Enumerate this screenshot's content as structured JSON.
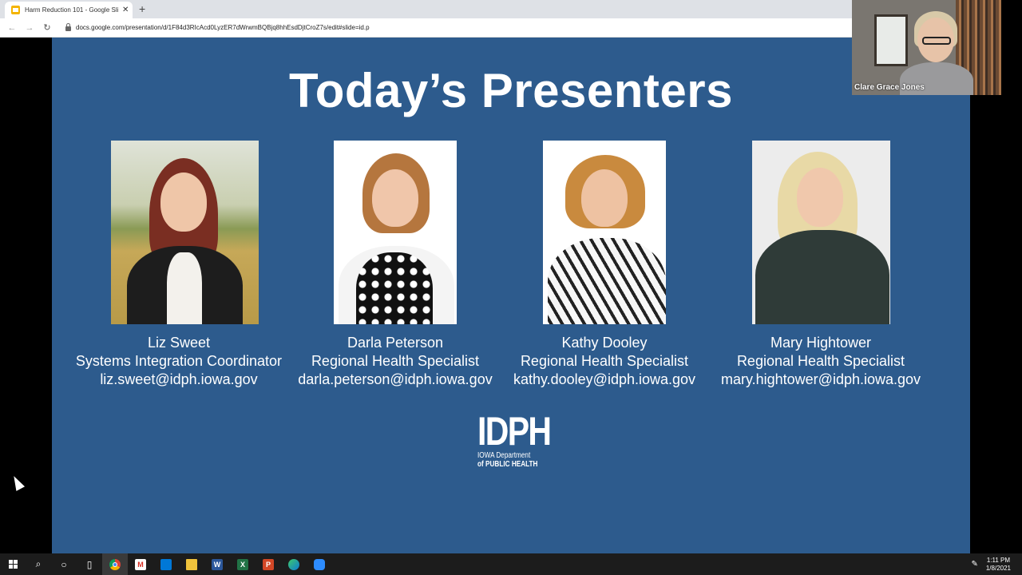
{
  "browser": {
    "tab_title": "Harm Reduction 101 - Google Sli",
    "tab_close": "✕",
    "new_tab": "+",
    "url": "docs.google.com/presentation/d/1F84d3RIcAcd0LyzER7dWrwmBQBjq8hhEsdDjtCroZ7s/edit#slide=id.p"
  },
  "slide": {
    "title": "Today’s Presenters",
    "presenters": [
      {
        "name": "Liz Sweet",
        "role": "Systems Integration Coordinator",
        "email": "liz.sweet@idph.iowa.gov"
      },
      {
        "name": "Darla Peterson",
        "role": "Regional Health Specialist",
        "email": "darla.peterson@idph.iowa.gov"
      },
      {
        "name": "Kathy Dooley",
        "role": "Regional Health Specialist",
        "email": "kathy.dooley@idph.iowa.gov"
      },
      {
        "name": "Mary Hightower",
        "role": "Regional Health Specialist",
        "email": "mary.hightower@idph.iowa.gov"
      }
    ],
    "logo": {
      "big": "IDPH",
      "line1": "IOWA Department",
      "line2": "of PUBLIC HEALTH"
    }
  },
  "video": {
    "participant_name": "Clare Grace Jones"
  },
  "taskbar": {
    "icons": [
      "windows-start-icon",
      "search-icon",
      "cortana-icon",
      "task-view-icon",
      "chrome-icon",
      "gmail-icon",
      "store-icon",
      "file-explorer-icon",
      "word-icon",
      "excel-icon",
      "powerpoint-icon",
      "edge-icon",
      "zoom-icon"
    ],
    "word_letter": "W",
    "excel_letter": "X",
    "ppt_letter": "P",
    "time": "1:11 PM",
    "date": "1/8/2021"
  },
  "colors": {
    "slide_bg": "#2d5b8d",
    "taskbar_bg": "#1c1c1c",
    "tab_bar_bg": "#dee1e6"
  }
}
